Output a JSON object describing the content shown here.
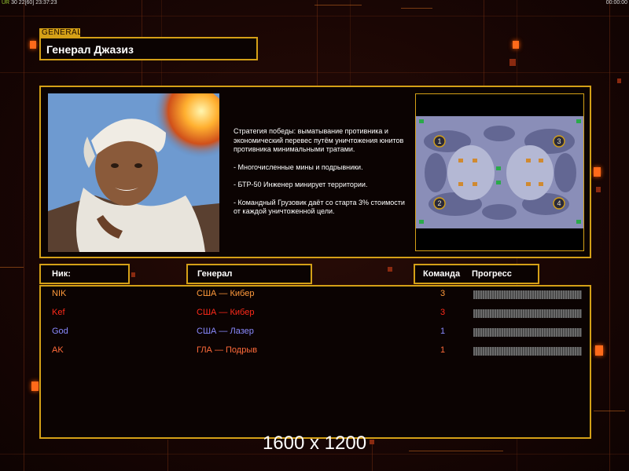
{
  "status_bar": {
    "left_tag": "UR",
    "left_text": "30 22[60] 23:37:23",
    "right_text": "00:00:00"
  },
  "general": {
    "tab_label": "GENERAL",
    "name": "Генерал Джазиз"
  },
  "description": {
    "strategy": "Стратегия победы: выматывание противника и экономический перевес путём уничтожения юнитов противника минимальными тратами.",
    "points": [
      "- Многочисленные мины и подрывники.",
      "- БТР-50 Инженер минирует территории.",
      "- Командный Грузовик даёт со старта 3% стоимости от каждой уничтоженной цели."
    ]
  },
  "minimap": {
    "start_positions": [
      "1",
      "2",
      "3",
      "4"
    ]
  },
  "table": {
    "headers": {
      "nick": "Ник:",
      "general": "Генерал",
      "team": "Команда",
      "progress": "Прогресс"
    },
    "rows": [
      {
        "nick": "NIK",
        "general": "США — Кибер",
        "team": "3",
        "color": "#ff9a3c",
        "progress": 0
      },
      {
        "nick": "Kef",
        "general": "США — Кибер",
        "team": "3",
        "color": "#ff2a1a",
        "progress": 0
      },
      {
        "nick": "God",
        "general": "США — Лазер",
        "team": "1",
        "color": "#8a8aff",
        "progress": 0
      },
      {
        "nick": "AK",
        "general": "ГЛА — Подрыв",
        "team": "1",
        "color": "#ff6a3a",
        "progress": 0
      }
    ]
  },
  "resolution_label": "1600 x 1200",
  "colors": {
    "accent": "#d4a017",
    "panel_bg": "#0b0302"
  }
}
